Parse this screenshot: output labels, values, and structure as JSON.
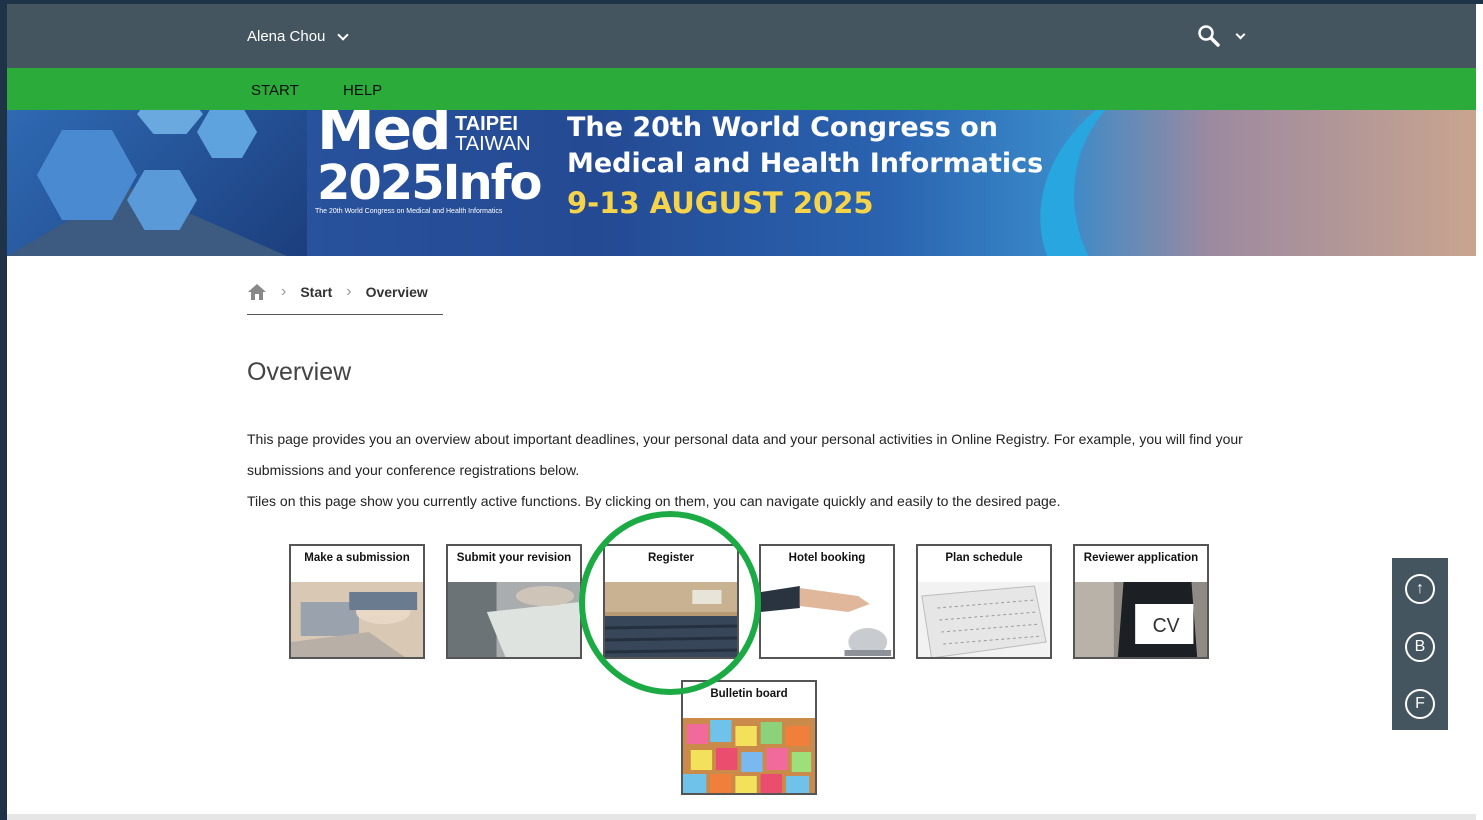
{
  "topbar": {
    "user_name": "Alena Chou"
  },
  "nav": {
    "items": [
      "START",
      "HELP"
    ]
  },
  "banner": {
    "logo_main_1": "Med",
    "logo_main_2": "2025Info",
    "logo_city": "TAIPEI",
    "logo_country": "TAIWAN",
    "logo_caption": "The 20th World Congress on Medical and Health Informatics",
    "title_line1": "The 20th World Congress on",
    "title_line2": "Medical and Health Informatics",
    "date": "9-13 AUGUST 2025"
  },
  "breadcrumb": {
    "items": [
      "Start",
      "Overview"
    ]
  },
  "page": {
    "title": "Overview",
    "intro_1": "This page provides you an overview about important deadlines, your personal data and your personal activities in Online Registry. For example, you will find your submissions and your conference registrations below.",
    "intro_2": "Tiles on this page show you currently active functions. By clicking on them, you can navigate quickly and easily to the desired page."
  },
  "tiles": [
    {
      "label": "Make a submission",
      "icon": "laptop-typing-photo"
    },
    {
      "label": "Submit your revision",
      "icon": "laptop-documents-photo"
    },
    {
      "label": "Register",
      "icon": "lecture-hall-photo"
    },
    {
      "label": "Hotel booking",
      "icon": "service-bell-photo"
    },
    {
      "label": "Plan schedule",
      "icon": "calendar-photo"
    },
    {
      "label": "Reviewer application",
      "icon": "cv-card-photo"
    },
    {
      "label": "Bulletin board",
      "icon": "sticky-notes-photo"
    }
  ],
  "sidetools": {
    "up": "↑",
    "b": "B",
    "f": "F"
  },
  "colors": {
    "topbar": "#44555f",
    "navbar": "#2bab3a",
    "highlight_circle": "#1caa45"
  }
}
